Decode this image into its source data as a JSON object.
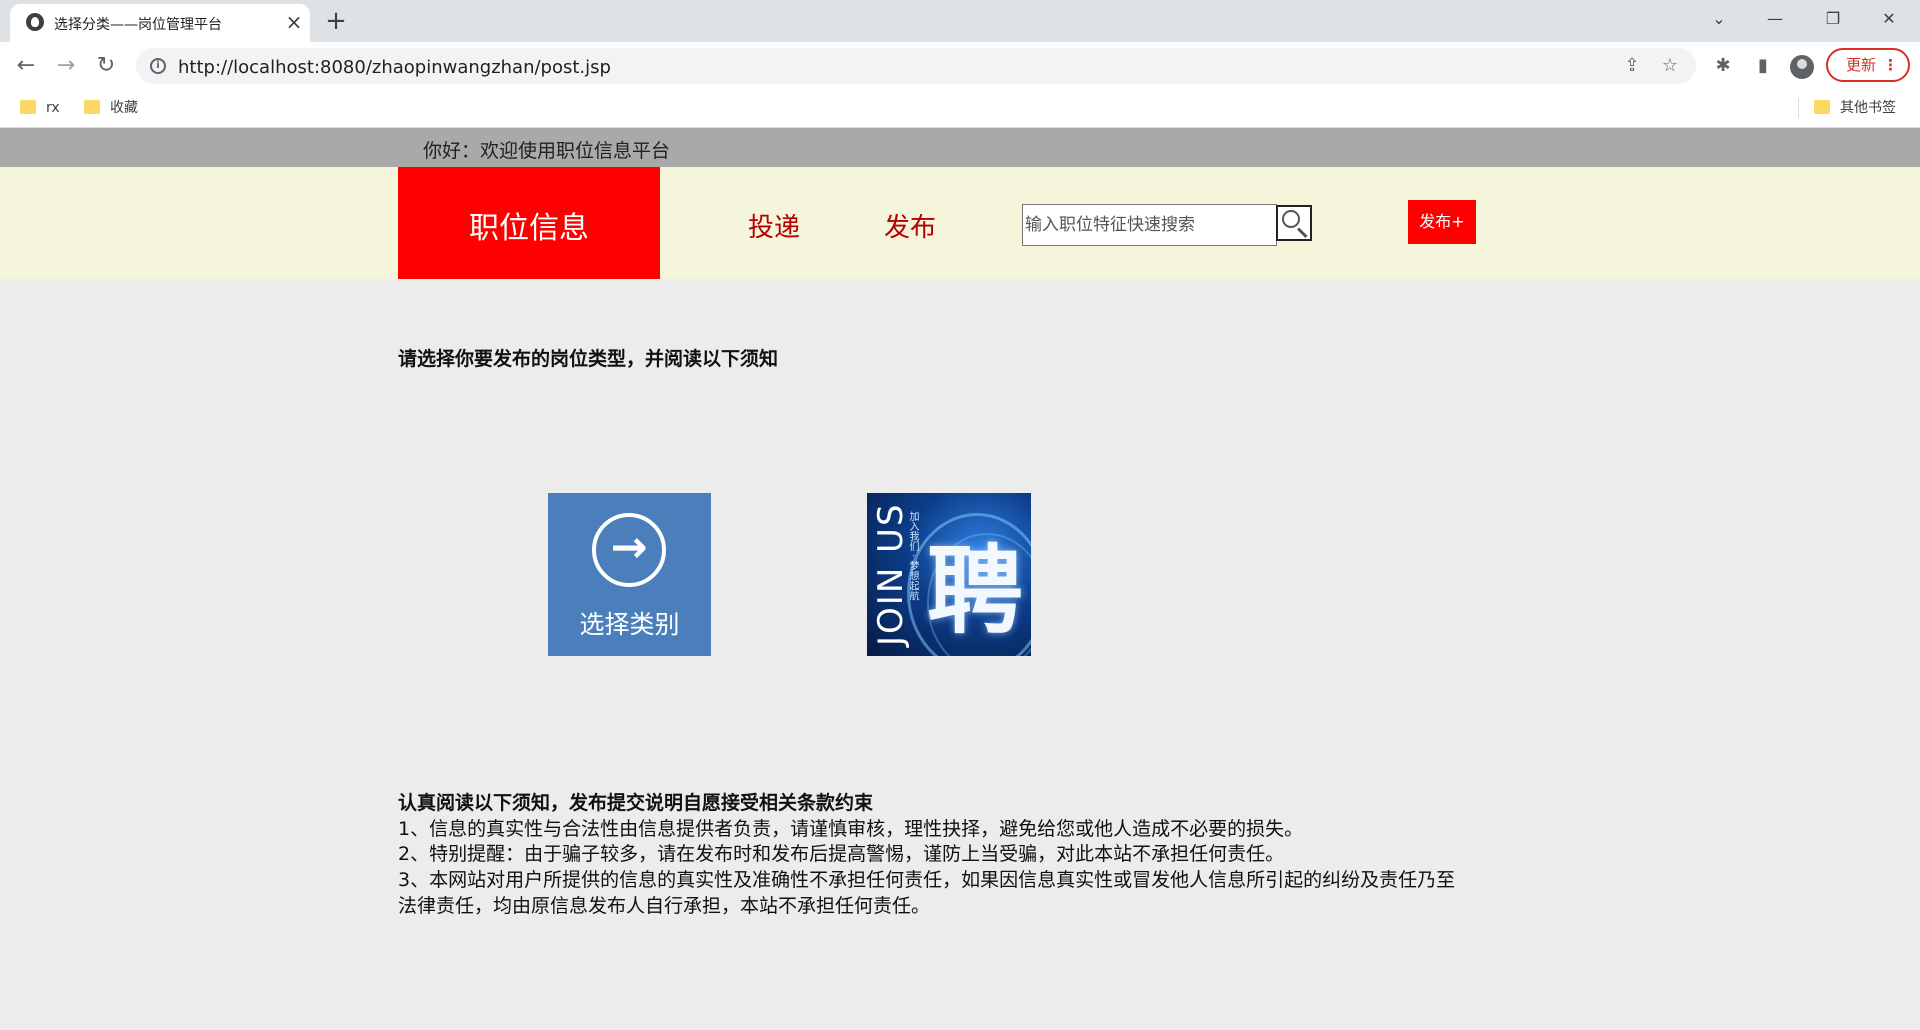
{
  "browser": {
    "tab_title": "选择分类——岗位管理平台",
    "tab_close": "×",
    "new_tab": "+",
    "url": "http://localhost:8080/zhaopinwangzhan/post.jsp",
    "update_label": "更新",
    "bookmarks": [
      {
        "label": "rx",
        "icon": "folder-icon"
      },
      {
        "label": "收藏",
        "icon": "folder-icon"
      }
    ],
    "other_bookmarks": "其他书签",
    "window_controls": [
      "chevron-down-icon",
      "minimize-icon",
      "restore-icon",
      "close-icon"
    ]
  },
  "page": {
    "welcome": "你好：欢迎使用职位信息平台",
    "logo": "职位信息",
    "nav": [
      "投递",
      "发布"
    ],
    "search_placeholder": "输入职位特征快速搜索",
    "publish_button": "发布+",
    "heading": "请选择你要发布的岗位类型，并阅读以下须知",
    "select_tile_label": "选择类别",
    "join_banner": {
      "text": "JOIN US",
      "sub": "加入我们 · 梦想起航",
      "char": "聘"
    },
    "notice": {
      "title": "认真阅读以下须知，发布提交说明自愿接受相关条款约束",
      "lines": [
        "1、信息的真实性与合法性由信息提供者负责，请谨慎审核，理性抉择，避免给您或他人造成不必要的损失。",
        "2、特别提醒：由于骗子较多，请在发布时和发布后提高警惕，谨防上当受骗，对此本站不承担任何责任。",
        "3、本网站对用户所提供的信息的真实性及准确性不承担任何责任，如果因信息真实性或冒发他人信息所引起的纠纷及责任乃至",
        "法律责任，均由原信息发布人自行承担，本站不承担任何责任。"
      ]
    }
  },
  "colors": {
    "brand_red": "#ff0000",
    "nav_text": "#b40000",
    "header_bg": "#f5f5dc",
    "welcome_bar": "#a9a9a9",
    "tile_blue": "#4a7fbc"
  }
}
